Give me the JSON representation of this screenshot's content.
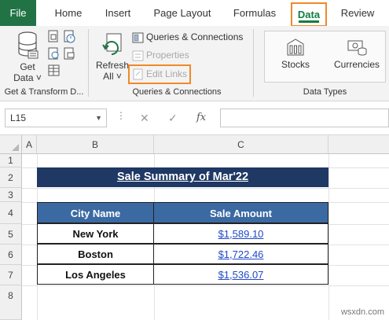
{
  "ribbon_tabs": [
    "File",
    "Home",
    "Insert",
    "Page Layout",
    "Formulas",
    "Data",
    "Review"
  ],
  "groups": {
    "get_transform": {
      "get_data_line1": "Get",
      "get_data_line2": "Data ˅",
      "label": "Get & Transform D..."
    },
    "queries": {
      "refresh_line1": "Refresh",
      "refresh_line2": "All ˅",
      "queries_connections": "Queries & Connections",
      "properties": "Properties",
      "edit_links": "Edit Links",
      "label": "Queries & Connections"
    },
    "data_types": {
      "stocks": "Stocks",
      "currencies": "Currencies",
      "label": "Data Types"
    }
  },
  "formula_bar": {
    "name_box": "L15",
    "cancel_icon": "✕",
    "enter_icon": "✓",
    "fx": "fx",
    "value": ""
  },
  "sheet": {
    "columns": [
      "A",
      "B",
      "C"
    ],
    "rows": [
      "1",
      "2",
      "3",
      "4",
      "5",
      "6",
      "7",
      "8"
    ],
    "title": "Sale Summary of Mar'22",
    "headers": [
      "City Name",
      "Sale Amount"
    ],
    "table": [
      {
        "city": "New York",
        "amount": "$1,589.10"
      },
      {
        "city": "Boston",
        "amount": "$1,722.46"
      },
      {
        "city": "Los Angeles",
        "amount": "$1,536.07"
      }
    ]
  },
  "watermark": "wsxdn.com",
  "colors": {
    "excel_green": "#217346",
    "highlight_orange": "#f0892a",
    "title_fill": "#1f3864",
    "header_fill": "#3b6aa3",
    "link_blue": "#1f49c8"
  }
}
